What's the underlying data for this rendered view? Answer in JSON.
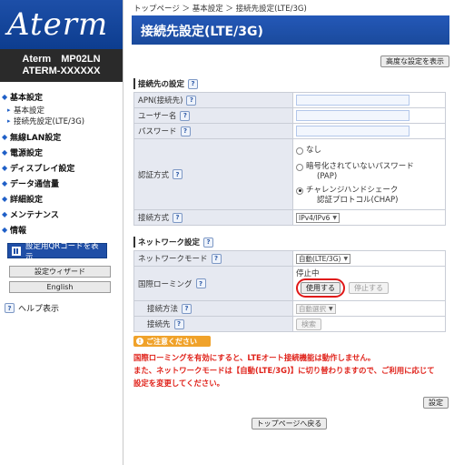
{
  "sidebar": {
    "logo": "Aterm",
    "device_line1": "Aterm　MP02LN",
    "device_line2": "ATERM-XXXXXX",
    "menu": [
      {
        "label": "基本設定",
        "subs": [
          "基本設定",
          "接続先設定(LTE/3G)"
        ]
      },
      {
        "label": "無線LAN設定"
      },
      {
        "label": "電源設定"
      },
      {
        "label": "ディスプレイ設定"
      },
      {
        "label": "データ通信量"
      },
      {
        "label": "詳細設定"
      },
      {
        "label": "メンテナンス"
      },
      {
        "label": "情報"
      }
    ],
    "qr_button": "設定用QRコードを表示",
    "wizard_button": "設定ウィザード",
    "english_button": "English",
    "help_label": "ヘルプ表示"
  },
  "main": {
    "breadcrumb": "トップページ ＞ 基本設定 ＞ 接続先設定(LTE/3G)",
    "title": "接続先設定(LTE/3G)",
    "advanced_button": "高度な設定を表示",
    "help_mark": "?",
    "section1": {
      "title": "接続先の設定",
      "apn_label": "APN(接続先)",
      "user_label": "ユーザー名",
      "password_label": "パスワード",
      "auth_label": "認証方式",
      "auth_options": [
        "なし",
        "暗号化されていないパスワード",
        "(PAP)",
        "チャレンジハンドシェーク",
        "認証プロトコル(CHAP)"
      ],
      "auth_selected": "CHAP",
      "conn_type_label": "接続方式",
      "conn_type_value": "IPv4/IPv6"
    },
    "section2": {
      "title": "ネットワーク設定",
      "network_mode_label": "ネットワークモード",
      "network_mode_value": "自動(LTE/3G)",
      "roaming_label": "国際ローミング",
      "roaming_status": "停止中",
      "use_button": "使用する",
      "stop_button": "停止する",
      "method_label": "接続方法",
      "method_value": "自動選択",
      "destination_label": "接続先",
      "search_button": "検索"
    },
    "notice_title": "ご注意ください",
    "notice_line1": "国際ローミングを有効にすると、LTEオート接続機能は動作しません。",
    "notice_line2": "また、ネットワークモードは【自動(LTE/3G)】に切り替わりますので、ご利用に応じて",
    "notice_line3": "設定を変更してください。",
    "apply_button": "設定",
    "back_button": "トップページへ戻る"
  },
  "colors": {
    "title_bar": "#1f50a8",
    "label_bg": "#e6e9f1",
    "notice": "#e0231b",
    "notice_badge": "#f0a22a",
    "circle_highlight": "#e01818"
  }
}
